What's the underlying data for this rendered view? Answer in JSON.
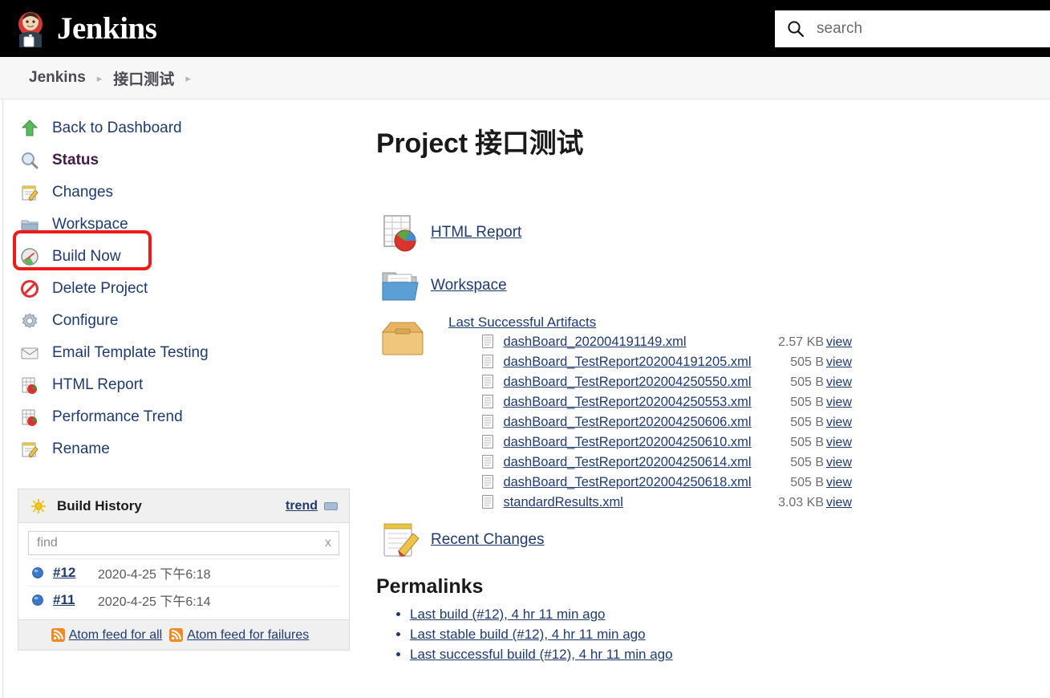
{
  "header": {
    "brand_title": "Jenkins",
    "logo_icon": "jenkins-butler-logo",
    "search_placeholder": "search",
    "search_value": "",
    "search_icon": "search-icon"
  },
  "breadcrumb": {
    "items": [
      {
        "label": "Jenkins"
      },
      {
        "label": "接口测试"
      }
    ],
    "separator": "▸"
  },
  "sidebar": {
    "tasks": [
      {
        "label": "Back to Dashboard",
        "icon": "up-arrow-icon",
        "active": false
      },
      {
        "label": "Status",
        "icon": "magnifier-icon",
        "active": true
      },
      {
        "label": "Changes",
        "icon": "notepad-pencil-icon",
        "active": false
      },
      {
        "label": "Workspace",
        "icon": "folder-icon",
        "active": false
      },
      {
        "label": "Build Now",
        "icon": "build-clock-icon",
        "active": false
      },
      {
        "label": "Delete Project",
        "icon": "delete-forbidden-icon",
        "active": false
      },
      {
        "label": "Configure",
        "icon": "gear-icon",
        "active": false
      },
      {
        "label": "Email Template Testing",
        "icon": "envelope-icon",
        "active": false
      },
      {
        "label": "HTML Report",
        "icon": "report-chart-icon",
        "active": false
      },
      {
        "label": "Performance Trend",
        "icon": "report-chart-icon",
        "active": false
      },
      {
        "label": "Rename",
        "icon": "notepad-pencil-icon",
        "active": false
      }
    ],
    "highlight_target": "Build Now",
    "highlight_color": "#ee1c18"
  },
  "build_history": {
    "title": "Build History",
    "sun_icon": "sun-icon",
    "trend_label": "trend",
    "collapse_icon": "collapse-icon",
    "find_placeholder": "find",
    "find_value": "",
    "find_clear_label": "x",
    "builds": [
      {
        "number": "#12",
        "time": "2020-4-25 下午6:18",
        "status_icon": "blue-ball-icon"
      },
      {
        "number": "#11",
        "time": "2020-4-25 下午6:14",
        "status_icon": "blue-ball-icon"
      }
    ],
    "feeds": [
      {
        "label": "Atom feed for all",
        "icon": "rss-icon"
      },
      {
        "label": "Atom feed for failures",
        "icon": "rss-icon"
      }
    ]
  },
  "main": {
    "project_title": "Project 接口测试",
    "links": [
      {
        "label": "HTML Report",
        "icon": "report-chart-icon"
      },
      {
        "label": "Workspace",
        "icon": "folder-blue-icon"
      }
    ],
    "artifacts": {
      "title": "Last Successful Artifacts",
      "box_icon": "package-box-icon",
      "view_label": "view",
      "files": [
        {
          "name": "dashBoard_202004191149.xml",
          "size": "2.57 KB",
          "indent": "deep"
        },
        {
          "name": "dashBoard_TestReport202004191205.xml",
          "size": "505 B",
          "indent": "deep"
        },
        {
          "name": "dashBoard_TestReport202004250550.xml",
          "size": "505 B",
          "indent": "deep"
        },
        {
          "name": "dashBoard_TestReport202004250553.xml",
          "size": "505 B",
          "indent": "deep"
        },
        {
          "name": "dashBoard_TestReport202004250606.xml",
          "size": "505 B",
          "indent": "deep"
        },
        {
          "name": "dashBoard_TestReport202004250610.xml",
          "size": "505 B",
          "indent": "deep"
        },
        {
          "name": "dashBoard_TestReport202004250614.xml",
          "size": "505 B",
          "indent": "deep"
        },
        {
          "name": "dashBoard_TestReport202004250618.xml",
          "size": "505 B",
          "indent": "deep"
        },
        {
          "name": "standardResults.xml",
          "size": "3.03 KB",
          "indent": "shallow"
        }
      ]
    },
    "recent_changes": {
      "label": "Recent Changes",
      "icon": "notepad-pencil-icon"
    },
    "permalinks_title": "Permalinks",
    "permalinks": [
      {
        "label": "Last build (#12), 4 hr 11 min ago"
      },
      {
        "label": "Last stable build (#12), 4 hr 11 min ago"
      },
      {
        "label": "Last successful build (#12), 4 hr 11 min ago"
      }
    ]
  },
  "colors": {
    "header_bg": "#000000",
    "link": "#1f3a6e",
    "active_link": "#43194a",
    "highlight": "#ee1c18"
  }
}
